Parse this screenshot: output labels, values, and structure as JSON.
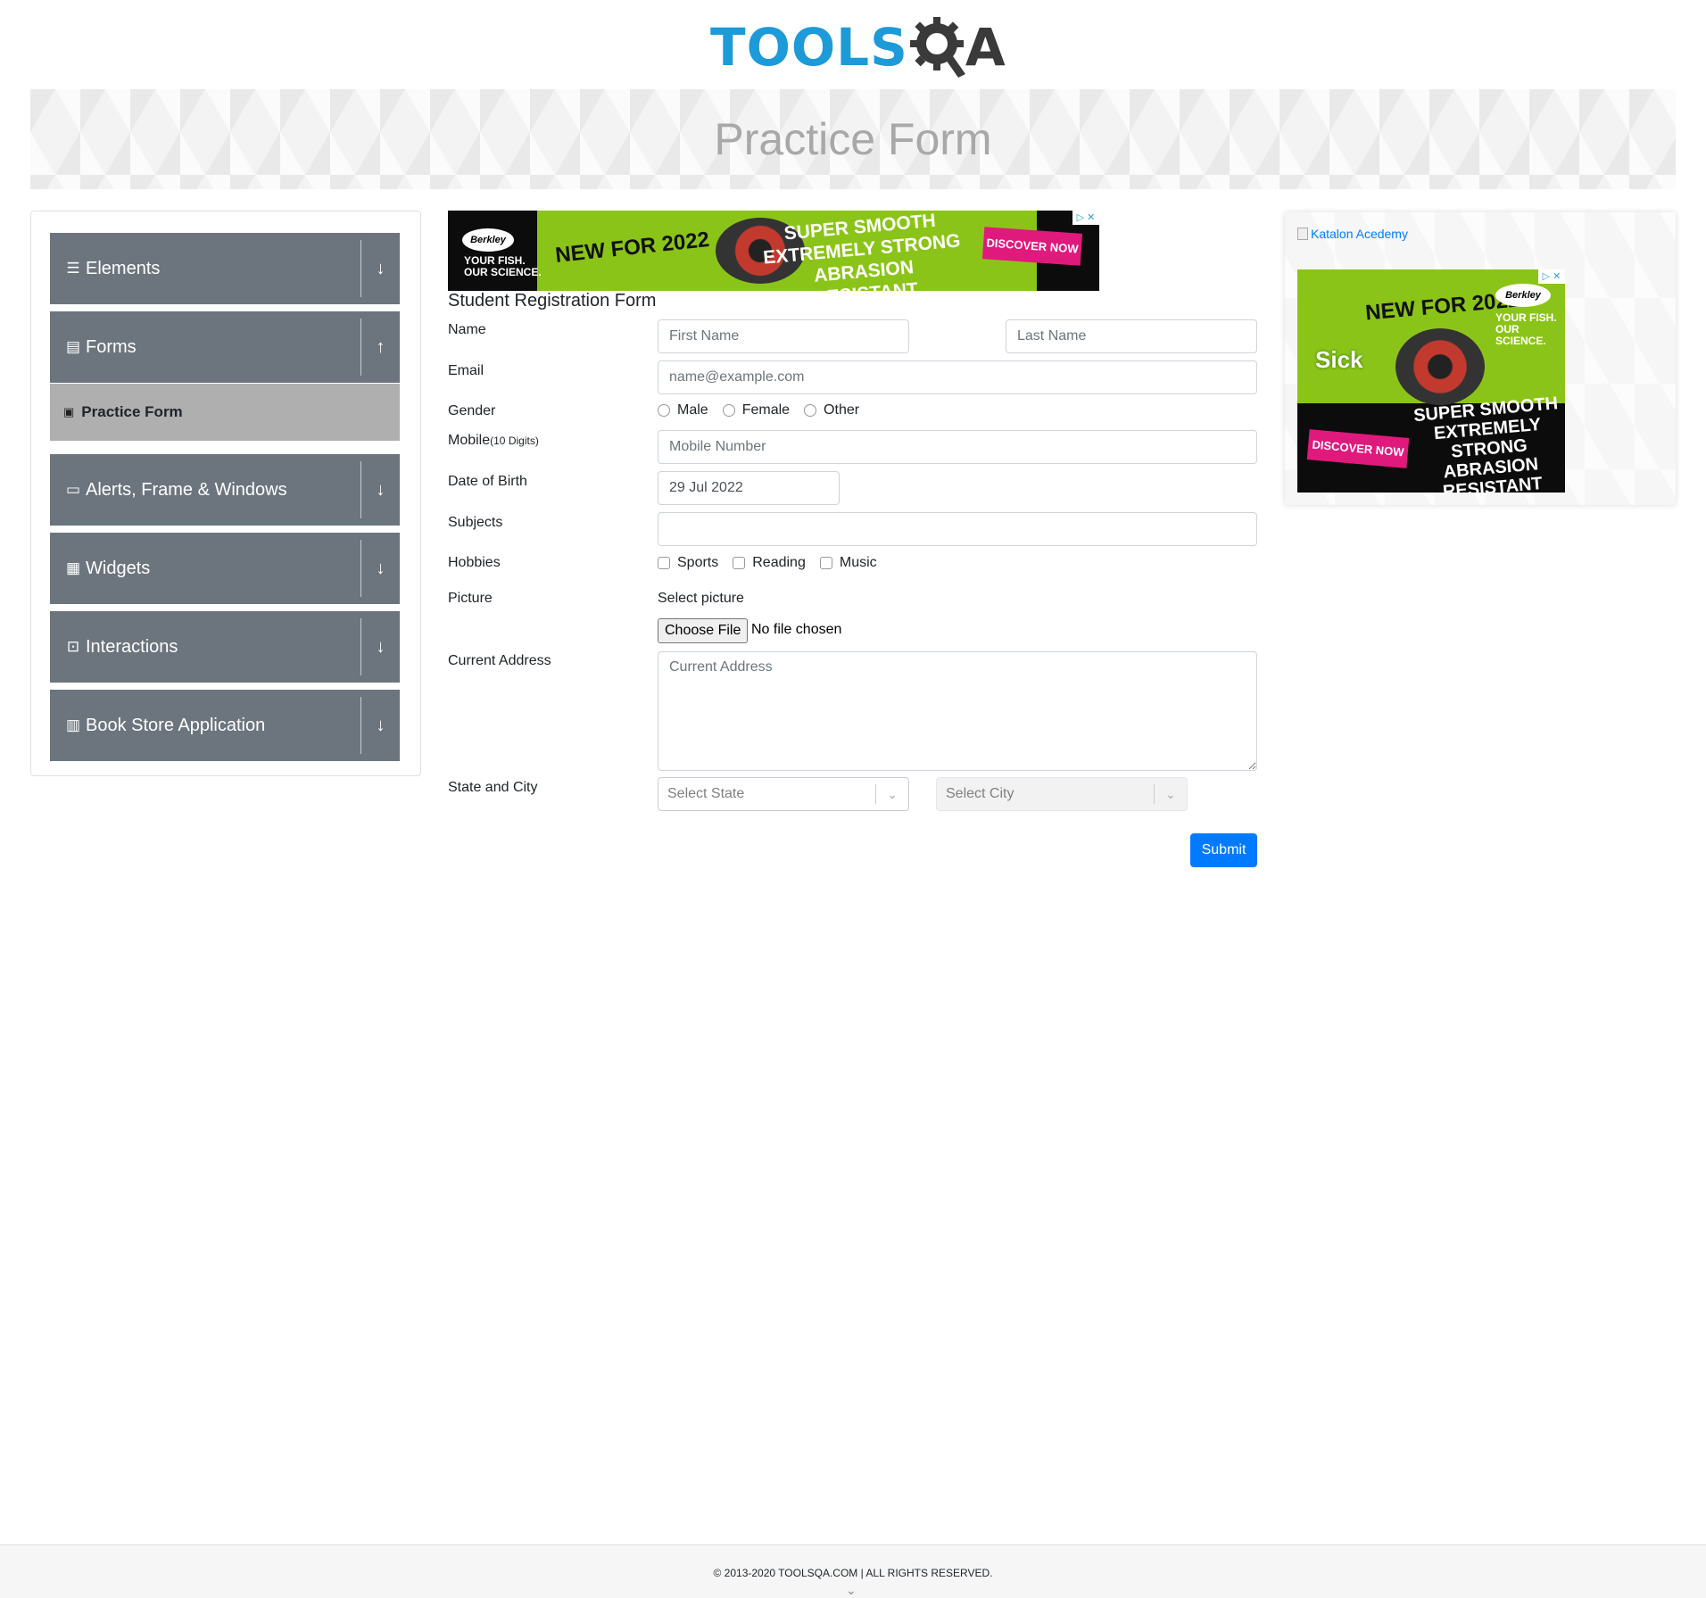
{
  "header": {
    "logo_part1": "TOOLS",
    "logo_part2": "QA",
    "page_title": "Practice Form"
  },
  "sidebar": {
    "groups": [
      {
        "label": "Elements",
        "icon": "menu-icon",
        "arrow": "↓"
      },
      {
        "label": "Forms",
        "icon": "document-icon",
        "arrow": "↑"
      },
      {
        "label": "Alerts, Frame & Windows",
        "icon": "window-icon",
        "arrow": "↓"
      },
      {
        "label": "Widgets",
        "icon": "widgets-icon",
        "arrow": "↓"
      },
      {
        "label": "Interactions",
        "icon": "interactions-icon",
        "arrow": "↓"
      },
      {
        "label": "Book Store Application",
        "icon": "books-icon",
        "arrow": "↓"
      }
    ],
    "active_item": "Practice Form"
  },
  "ads": {
    "top": {
      "brand": "Berkley",
      "slogan_line1": "YOUR FISH.",
      "slogan_line2": "OUR SCIENCE.",
      "new_text": "NEW FOR 2022",
      "headline_1": "SUPER SMOOTH",
      "headline_2": "EXTREMELY STRONG",
      "headline_3": "ABRASION RESISTANT",
      "cta": "DISCOVER NOW",
      "close": "▷ ✕"
    },
    "side": {
      "katalon_alt": "Katalon Acedemy",
      "brand": "Berkley",
      "slogan_line1": "YOUR FISH.",
      "slogan_line2": "OUR SCIENCE.",
      "new_text": "NEW FOR 2022",
      "product": "Sick",
      "headline_1": "SUPER SMOOTH",
      "headline_2": "EXTREMELY STRONG",
      "headline_3": "ABRASION RESISTANT",
      "cta": "DISCOVER NOW",
      "close": "▷ ✕"
    }
  },
  "form": {
    "title": "Student Registration Form",
    "name_label": "Name",
    "first_name_placeholder": "First Name",
    "last_name_placeholder": "Last Name",
    "email_label": "Email",
    "email_placeholder": "name@example.com",
    "gender_label": "Gender",
    "gender_options": [
      "Male",
      "Female",
      "Other"
    ],
    "mobile_label": "Mobile",
    "mobile_hint": "(10 Digits)",
    "mobile_placeholder": "Mobile Number",
    "dob_label": "Date of Birth",
    "dob_value": "29 Jul 2022",
    "subjects_label": "Subjects",
    "hobbies_label": "Hobbies",
    "hobby_options": [
      "Sports",
      "Reading",
      "Music"
    ],
    "picture_label": "Picture",
    "picture_select_label": "Select picture",
    "choose_file": "Choose File",
    "no_file": "No file chosen",
    "address_label": "Current Address",
    "address_placeholder": "Current Address",
    "state_city_label": "State and City",
    "state_placeholder": "Select State",
    "city_placeholder": "Select City",
    "submit": "Submit"
  },
  "footer": {
    "copyright": "© 2013-2020 TOOLSQA.COM | ALL RIGHTS RESERVED."
  },
  "colors": {
    "sidebar_group_bg": "#6c757d",
    "sidebar_active_bg": "#afafaf",
    "primary_button": "#007bff",
    "logo_blue": "#1d9ad8",
    "ad_green": "#8bc418",
    "ad_pink": "#e0197d"
  }
}
